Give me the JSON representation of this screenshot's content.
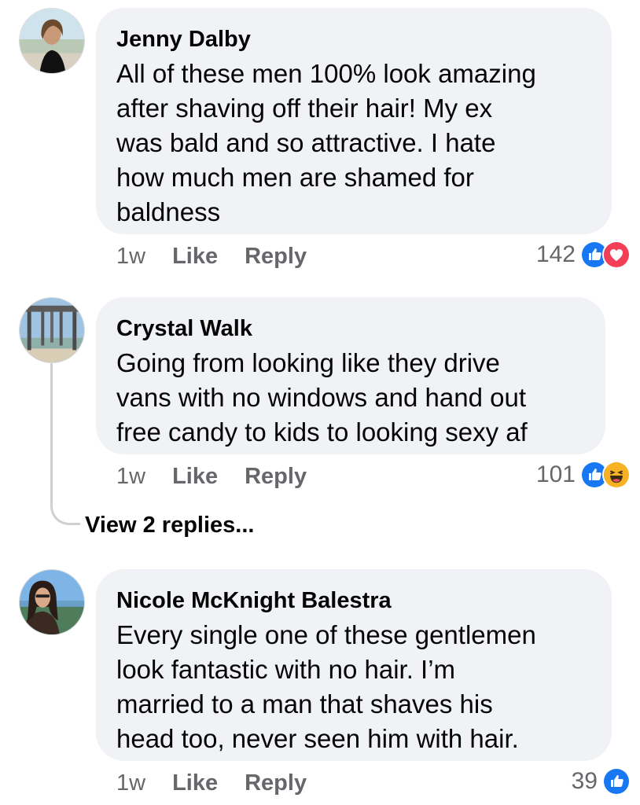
{
  "colors": {
    "bubble_bg": "#f0f2f5",
    "meta_text": "#65676b",
    "like_blue": "#1877f2",
    "love_red": "#f33e58",
    "haha_yellow": "#f7b125"
  },
  "comments": [
    {
      "author": "Jenny Dalby",
      "lines": [
        "All of these men 100% look amazing",
        "after shaving off their hair! My ex",
        "was bald and so attractive. I hate",
        "how much men are shamed for",
        "baldness"
      ],
      "time": "1w",
      "like_label": "Like",
      "reply_label": "Reply",
      "reaction_count": "142",
      "reactions": [
        "like-icon",
        "love-icon"
      ]
    },
    {
      "author": "Crystal Walk",
      "lines": [
        "Going from looking like they drive",
        "vans with no windows and hand out",
        "free candy to kids to looking sexy af"
      ],
      "time": "1w",
      "like_label": "Like",
      "reply_label": "Reply",
      "reaction_count": "101",
      "reactions": [
        "like-icon",
        "haha-icon"
      ],
      "view_replies": "View 2 replies..."
    },
    {
      "author": "Nicole McKnight Balestra",
      "lines": [
        "Every single one of these gentlemen",
        "look fantastic with no hair.  I’m",
        "married to a man that shaves his",
        "head too, never seen him with hair."
      ],
      "time": "1w",
      "like_label": "Like",
      "reply_label": "Reply",
      "reaction_count": "39",
      "reactions": [
        "like-icon"
      ]
    }
  ]
}
